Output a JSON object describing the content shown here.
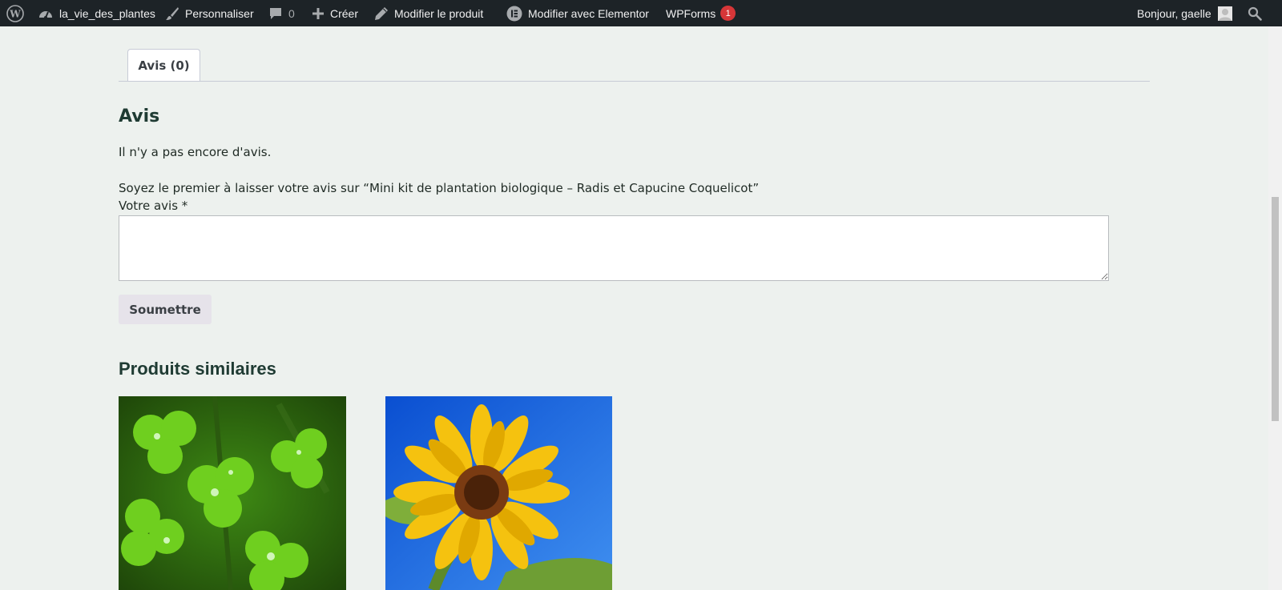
{
  "admin_bar": {
    "site_name": "la_vie_des_plantes",
    "customize": "Personnaliser",
    "comments_count": "0",
    "new": "Créer",
    "edit_product": "Modifier le produit",
    "elementor": "Modifier avec Elementor",
    "wpforms": "WPForms",
    "wpforms_badge": "1",
    "greeting": "Bonjour, gaelle"
  },
  "tabs": [
    {
      "label": "Avis (0)"
    }
  ],
  "reviews": {
    "heading": "Avis",
    "empty_text": "Il n'y a pas encore d'avis.",
    "prompt": "Soyez le premier à laisser votre avis sur “Mini kit de plantation biologique – Radis et Capucine Coquelicot”",
    "field_label": "Votre avis *",
    "field_value": "",
    "submit_label": "Soumettre"
  },
  "related": {
    "heading": "Produits similaires",
    "products": [
      {
        "image": "clover-photo"
      },
      {
        "image": "sunflower-photo"
      }
    ]
  },
  "colors": {
    "admin_bar_bg": "#1d2327",
    "page_bg": "#edf1ee",
    "heading": "#1f3b33",
    "badge": "#d63638"
  }
}
